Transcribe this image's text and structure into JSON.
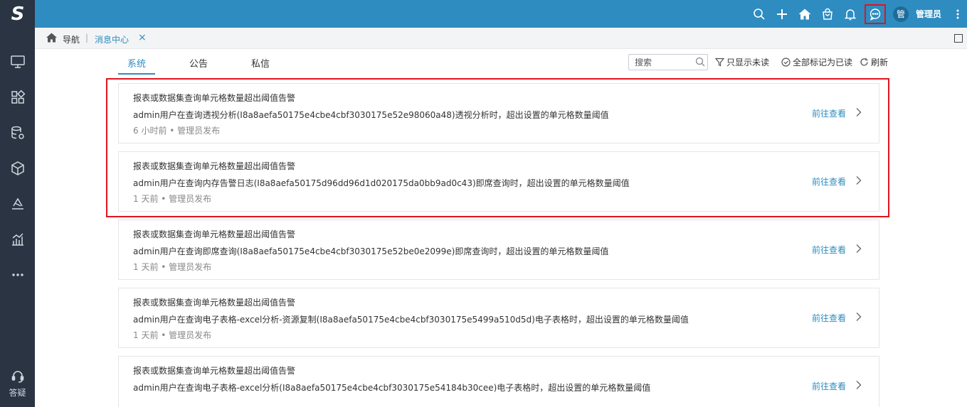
{
  "app": {
    "logo_text": "S",
    "help_label": "答疑",
    "brand_color": "#2e8cc0"
  },
  "sidebar": {
    "items": [
      {
        "icon": "monitor-icon"
      },
      {
        "icon": "apps-grid-icon"
      },
      {
        "icon": "database-gear-icon"
      },
      {
        "icon": "cube-icon"
      },
      {
        "icon": "layers-icon"
      },
      {
        "icon": "bar-chart-icon"
      },
      {
        "icon": "more-horizontal-icon"
      }
    ]
  },
  "topbar": {
    "user_avatar": "管",
    "user_name": "管理员",
    "icons": [
      "search-icon",
      "plus-icon",
      "home-icon",
      "bag-icon",
      "bell-icon",
      "chat-icon",
      "more-vertical-icon"
    ]
  },
  "breadcrumb": {
    "nav_label": "导航",
    "separator": "|",
    "tab_label": "消息中心",
    "close_symbol": "×"
  },
  "tabs": [
    {
      "label": "系统",
      "active": true
    },
    {
      "label": "公告",
      "active": false
    },
    {
      "label": "私信",
      "active": false
    }
  ],
  "tools": {
    "search_placeholder": "搜索",
    "unread_only": "只显示未读",
    "mark_all_read": "全部标记为已读",
    "refresh": "刷新"
  },
  "messages": [
    {
      "title": "报表或数据集查询单元格数量超出阈值告警",
      "body": "admin用户在查询透视分析(I8a8aefa50175e4cbe4cbf3030175e52e98060a48)透视分析时，超出设置的单元格数量阈值",
      "meta": "6 小时前 • 管理员发布",
      "link": "前往查看"
    },
    {
      "title": "报表或数据集查询单元格数量超出阈值告警",
      "body": "admin用户在查询内存告警日志(I8a8aefa50175d96dd96d1d020175da0bb9ad0c43)即席查询时，超出设置的单元格数量阈值",
      "meta": "1 天前 • 管理员发布",
      "link": "前往查看"
    },
    {
      "title": "报表或数据集查询单元格数量超出阈值告警",
      "body": "admin用户在查询即席查询(I8a8aefa50175e4cbe4cbf3030175e52be0e2099e)即席查询时，超出设置的单元格数量阈值",
      "meta": "1 天前 • 管理员发布",
      "link": "前往查看"
    },
    {
      "title": "报表或数据集查询单元格数量超出阈值告警",
      "body": "admin用户在查询电子表格-excel分析-资源复制(I8a8aefa50175e4cbe4cbf3030175e5499a510d5d)电子表格时，超出设置的单元格数量阈值",
      "meta": "1 天前 • 管理员发布",
      "link": "前往查看"
    },
    {
      "title": "报表或数据集查询单元格数量超出阈值告警",
      "body": "admin用户在查询电子表格-excel分析(I8a8aefa50175e4cbe4cbf3030175e54184b30cee)电子表格时，超出设置的单元格数量阈值",
      "meta": "",
      "link": "前往查看"
    }
  ]
}
